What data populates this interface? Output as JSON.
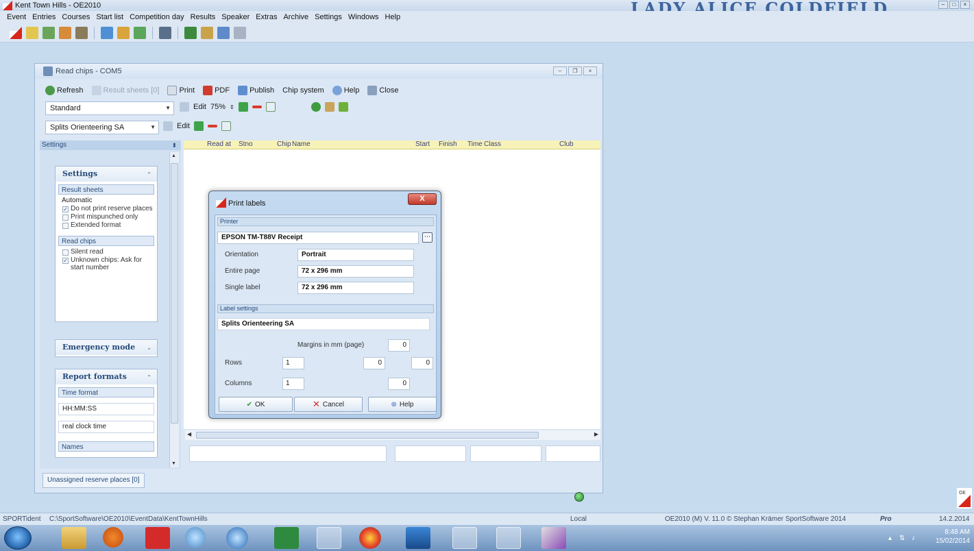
{
  "app": {
    "title": "Kent Town Hills - OE2010",
    "banner": "LADY ALICE COLDFIELD"
  },
  "menu": [
    "Event",
    "Entries",
    "Courses",
    "Start list",
    "Competition day",
    "Results",
    "Speaker",
    "Extras",
    "Archive",
    "Settings",
    "Windows",
    "Help"
  ],
  "read_chips": {
    "title": "Read chips - COM5",
    "toolbar": {
      "refresh": "Refresh",
      "result_sheets": "Result sheets [0]",
      "print": "Print",
      "pdf": "PDF",
      "publish": "Publish",
      "chip_system": "Chip system",
      "help": "Help",
      "close": "Close"
    },
    "layout_combo": "Standard",
    "edit_label": "Edit",
    "zoom": "75%",
    "splits_combo": "Splits Orienteering SA",
    "edit_label2": "Edit"
  },
  "settings_panel": {
    "header": "Settings",
    "group_settings": {
      "title": "Settings",
      "result_sheets": "Result sheets",
      "automatic": "Automatic",
      "do_not_print_reserve": "Do not print reserve places",
      "print_mispunched": "Print mispunched only",
      "extended_format": "Extended format"
    },
    "read_chips": {
      "title": "Read chips",
      "silent_read": "Silent read",
      "unknown_chips": "Unknown chips: Ask for start number"
    },
    "emergency_mode": "Emergency mode",
    "report_formats": {
      "title": "Report formats",
      "time_format": "Time format",
      "hms": "HH:MM:SS",
      "real_clock": "real clock time",
      "names": "Names"
    }
  },
  "table": {
    "columns": [
      "Read at",
      "Stno",
      "Chip",
      "Name",
      "Start",
      "Finish",
      "Time",
      "Class",
      "Club"
    ]
  },
  "unassigned": "Unassigned reserve places [0]",
  "dialog": {
    "title": "Print labels",
    "printer_section": "Printer",
    "printer_name": "EPSON TM-T88V Receipt",
    "orientation_label": "Orientation",
    "orientation_value": "Portrait",
    "entire_page_label": "Entire page",
    "entire_page_value": "72 x 296 mm",
    "single_label_label": "Single label",
    "single_label_value": "72 x 296 mm",
    "label_settings_section": "Label settings",
    "label_name": "Splits Orienteering SA",
    "margins_label": "Margins in mm (page)",
    "margin_top": "0",
    "rows_label": "Rows",
    "rows_value": "1",
    "margin_left": "0",
    "margin_right": "0",
    "columns_label": "Columns",
    "columns_value": "1",
    "margin_bottom": "0",
    "ok": "OK",
    "cancel": "Cancel",
    "help": "Help",
    "close_x": "X"
  },
  "statusbar": {
    "device": "SPORTident",
    "path": "C:\\SportSoftware\\OE2010\\EventData\\KentTownHills",
    "mode": "Local",
    "version": "OE2010 (M) V. 11.0 © Stephan Krämer SportSoftware 2014",
    "edition": "Pro",
    "date": "14.2.2014"
  },
  "taskbar": {
    "time": "8:48 AM",
    "date": "15/02/2014"
  }
}
